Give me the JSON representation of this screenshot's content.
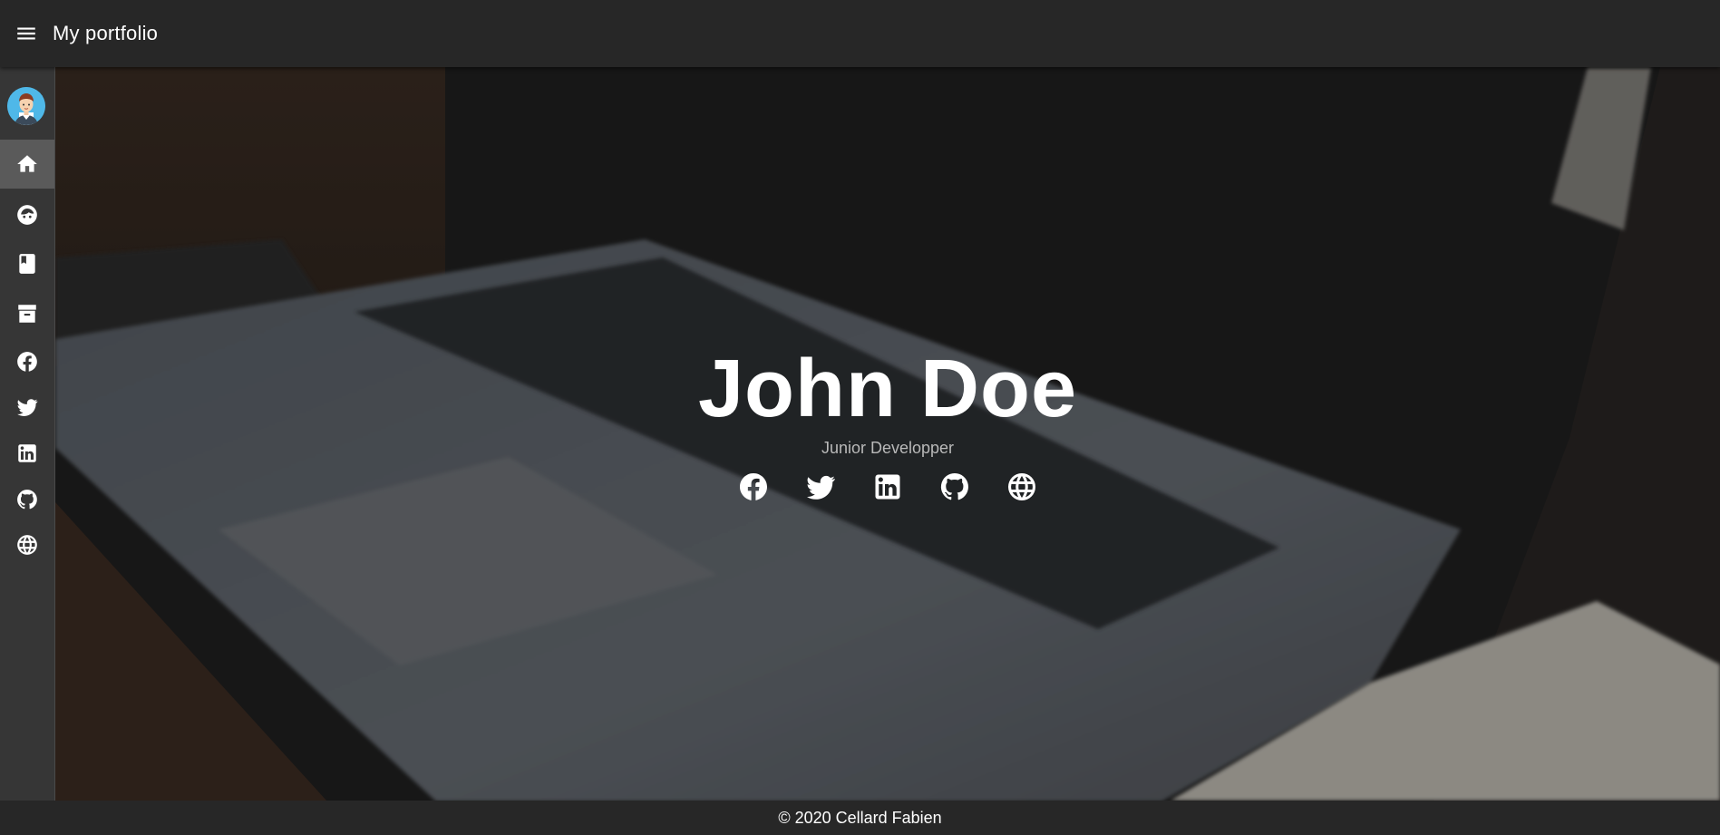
{
  "appbar": {
    "title": "My portfolio",
    "menu_icon": "menu-icon"
  },
  "rail": {
    "avatar_icon": "avatar-icon",
    "items": [
      {
        "name": "home",
        "icon": "home-icon",
        "active": true
      },
      {
        "name": "about",
        "icon": "face-icon",
        "active": false
      },
      {
        "name": "book",
        "icon": "book-icon",
        "active": false
      },
      {
        "name": "archive",
        "icon": "archive-icon",
        "active": false
      },
      {
        "name": "facebook",
        "icon": "facebook-icon",
        "active": false
      },
      {
        "name": "twitter",
        "icon": "twitter-icon",
        "active": false
      },
      {
        "name": "linkedin",
        "icon": "linkedin-icon",
        "active": false
      },
      {
        "name": "github",
        "icon": "github-icon",
        "active": false
      },
      {
        "name": "web",
        "icon": "web-icon",
        "active": false
      }
    ]
  },
  "hero": {
    "name": "John Doe",
    "subtitle": "Junior Developper",
    "socials": [
      "facebook-icon",
      "twitter-icon",
      "linkedin-icon",
      "github-icon",
      "web-icon"
    ]
  },
  "footer": {
    "text": "© 2020 Cellard Fabien"
  },
  "colors": {
    "appbar": "#272727",
    "rail": "#363636",
    "rail_active": "#5a5a5a",
    "subtitle": "#b9b9b9"
  }
}
